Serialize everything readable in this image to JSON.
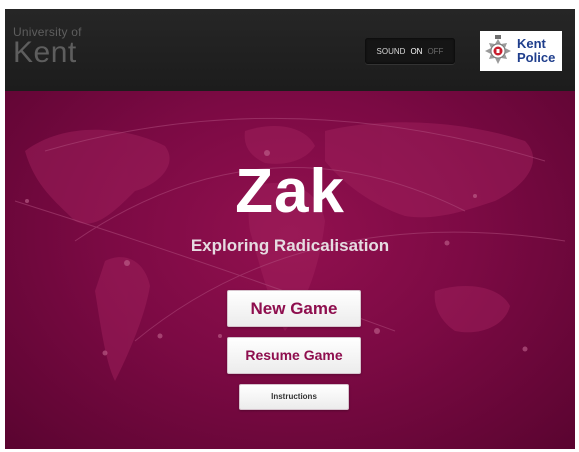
{
  "header": {
    "university": {
      "line1": "University of",
      "line2": "Kent"
    },
    "sound": {
      "label": "SOUND",
      "on": "ON",
      "off": "OFF"
    },
    "police": {
      "line1": "Kent",
      "line2": "Police"
    }
  },
  "main": {
    "title": "Zak",
    "subtitle": "Exploring Radicalisation",
    "buttons": {
      "new_game": "New Game",
      "resume_game": "Resume Game",
      "instructions": "Instructions"
    }
  },
  "colors": {
    "accent": "#8e0e4e",
    "background": "#7c0a44",
    "header": "#1f1f1f",
    "police_blue": "#1f3e8c"
  },
  "icons": {
    "police_badge": "police-crest-icon",
    "world_map": "world-map-background"
  }
}
